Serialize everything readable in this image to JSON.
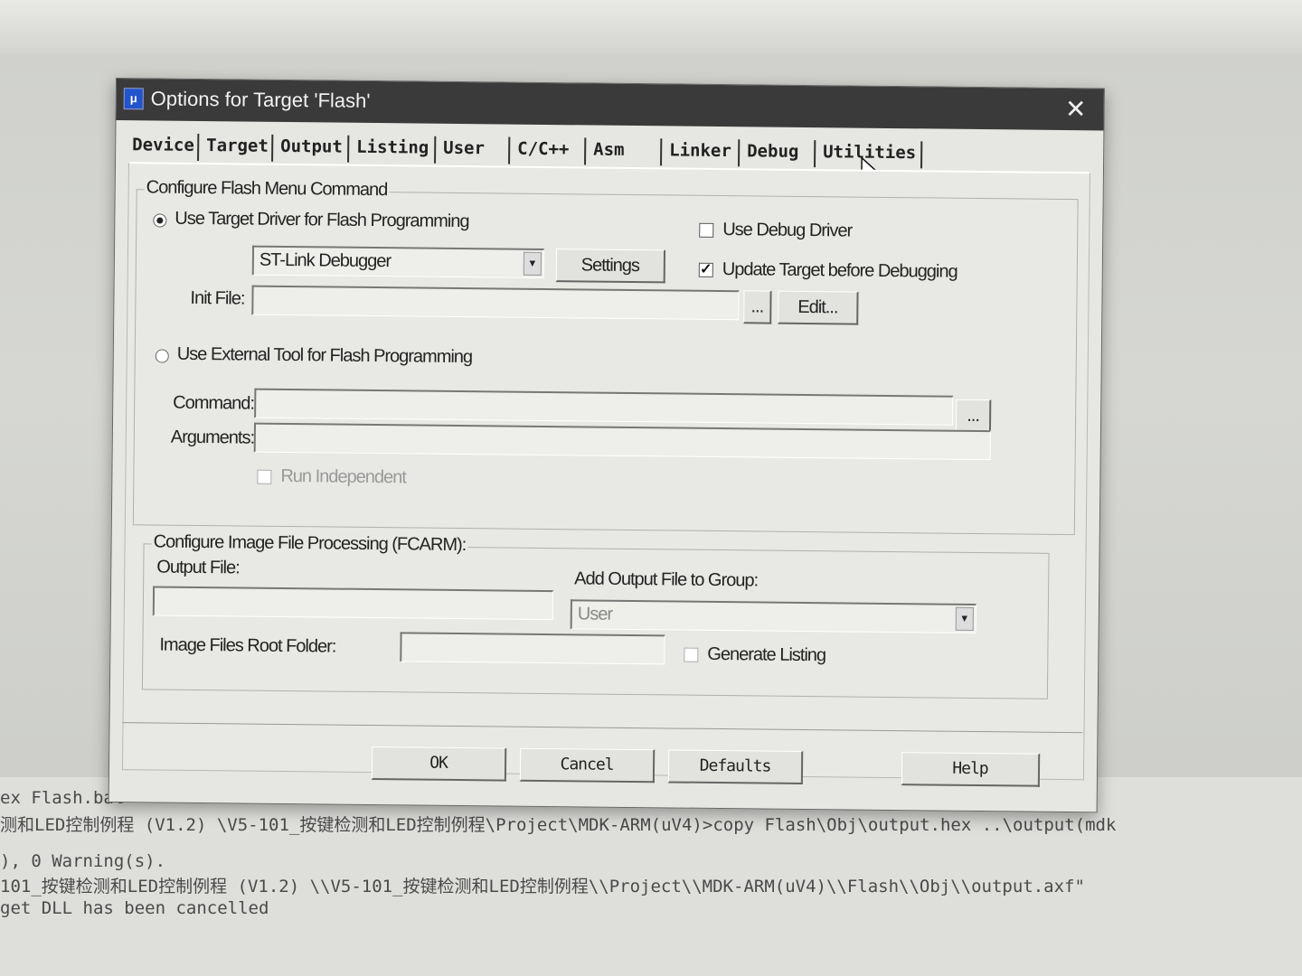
{
  "dialog": {
    "title": "Options for Target 'Flash'",
    "close_symbol": "✕",
    "icon": "keil-project-icon"
  },
  "tabs": [
    {
      "label": "Device"
    },
    {
      "label": "Target"
    },
    {
      "label": "Output"
    },
    {
      "label": "Listing"
    },
    {
      "label": "User"
    },
    {
      "label": "C/C++"
    },
    {
      "label": "Asm"
    },
    {
      "label": "Linker"
    },
    {
      "label": "Debug"
    },
    {
      "label": "Utilities",
      "active": true
    }
  ],
  "flash_menu": {
    "group_title": "Configure Flash Menu Command",
    "use_target_driver_label": "Use Target Driver for Flash Programming",
    "use_target_driver_selected": true,
    "driver_select_value": "ST-Link Debugger",
    "settings_label": "Settings",
    "use_debug_driver_label": "Use Debug Driver",
    "use_debug_driver_checked": false,
    "update_target_label": "Update Target before Debugging",
    "update_target_checked": true,
    "init_file_label": "Init File:",
    "init_file_value": "",
    "browse_label": "...",
    "edit_label": "Edit...",
    "use_external_tool_label": "Use External Tool for Flash Programming",
    "use_external_tool_selected": false,
    "command_label": "Command:",
    "command_value": "",
    "command_browse_label": "...",
    "arguments_label": "Arguments:",
    "arguments_value": "",
    "run_independent_label": "Run Independent",
    "run_independent_checked": false
  },
  "image_processing": {
    "group_title": "Configure Image File Processing (FCARM):",
    "output_file_label": "Output File:",
    "output_file_value": "",
    "add_to_group_label": "Add Output File  to Group:",
    "group_select_value": "User",
    "root_folder_label": "Image Files Root Folder:",
    "root_folder_value": "",
    "generate_listing_label": "Generate Listing",
    "generate_listing_checked": false
  },
  "buttons": {
    "ok": "OK",
    "cancel": "Cancel",
    "defaults": "Defaults",
    "help": "Help"
  },
  "build_output": [
    "ex Flash.bat",
    "测和LED控制例程 (V1.2) \\V5-101_按键检测和LED控制例程\\Project\\MDK-ARM(uV4)>copy Flash\\Obj\\output.hex ..\\output(mdk",
    "), 0 Warning(s).",
    "101_按键检测和LED控制例程 (V1.2) \\\\V5-101_按键检测和LED控制例程\\\\Project\\\\MDK-ARM(uV4)\\\\Flash\\\\Obj\\\\output.axf\"",
    "get DLL has been cancelled"
  ]
}
